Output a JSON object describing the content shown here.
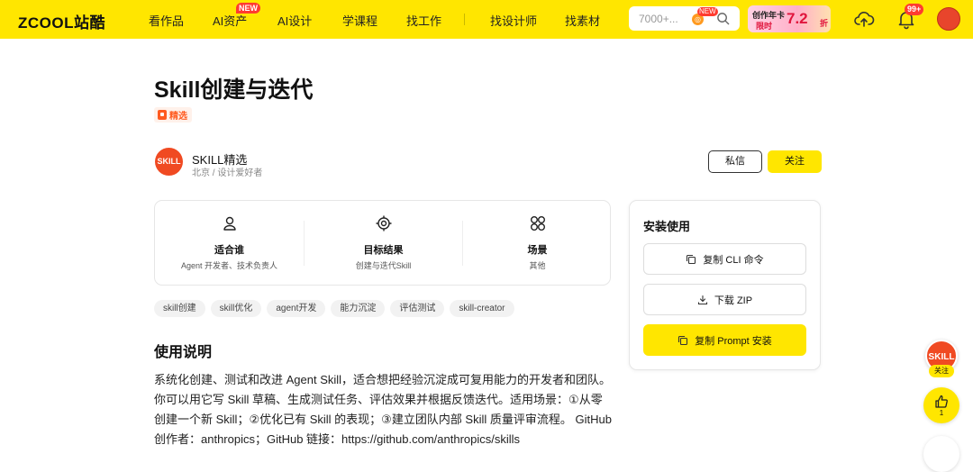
{
  "nav": {
    "logo": "ZCOOL站酷",
    "items": [
      "看作品",
      "AI资产",
      "AI设计",
      "学课程",
      "找工作",
      "找设计师",
      "找素材"
    ],
    "new_badge": "NEW",
    "search_placeholder": "7000+...",
    "search_new_badge": "NEW",
    "promo": {
      "line1": "创作年卡",
      "line2": "限时",
      "price": "7.2",
      "unit": "折"
    },
    "notifications": "99+"
  },
  "skill": {
    "title": "Skill创建与迭代",
    "featured_tag": "精选"
  },
  "author": {
    "avatar_text": "SKILL",
    "name": "SKILL精选",
    "meta": "北京 / 设计爱好者",
    "message_label": "私信",
    "follow_label": "关注"
  },
  "info": [
    {
      "icon": "user-icon",
      "heading": "适合谁",
      "value": "Agent 开发者、技术负责人"
    },
    {
      "icon": "target-icon",
      "heading": "目标结果",
      "value": "创建与迭代Skill"
    },
    {
      "icon": "grid-icon",
      "heading": "场景",
      "value": "其他"
    }
  ],
  "tags": [
    "skill创建",
    "skill优化",
    "agent开发",
    "能力沉淀",
    "评估测试",
    "skill-creator"
  ],
  "usage": {
    "title": "使用说明",
    "text": "系统化创建、测试和改进 Agent Skill，适合想把经验沉淀成可复用能力的开发者和团队。你可以用它写 Skill 草稿、生成测试任务、评估效果并根据反馈迭代。适用场景：①从零创建一个新 Skill；②优化已有 Skill 的表现；③建立团队内部 Skill 质量评审流程。 GitHub 创作者：anthropics；GitHub 链接：https://github.com/anthropics/skills"
  },
  "install": {
    "title": "安装使用",
    "copy_cli": "复制 CLI 命令",
    "download_zip": "下载 ZIP",
    "copy_prompt": "复制 Prompt 安装"
  },
  "float": {
    "avatar_text": "SKILL",
    "follow_label": "关注",
    "like_count": "1"
  },
  "colors": {
    "brand_yellow": "#ffe600",
    "accent_orange": "#f04a22",
    "badge_red": "#ff3b30"
  }
}
